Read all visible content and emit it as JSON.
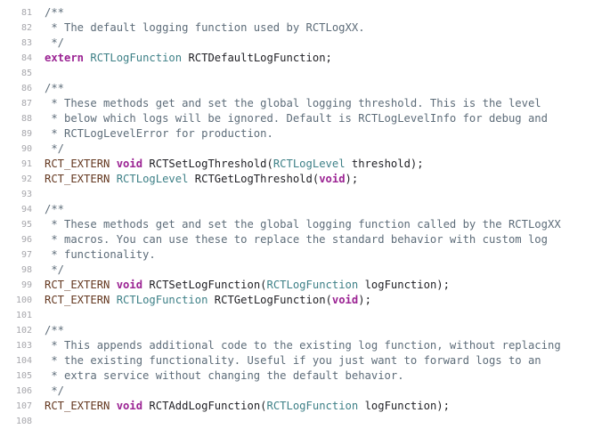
{
  "colors": {
    "background": "#ffffff",
    "line_number": "#a6a6ab",
    "comment": "#5d6c79",
    "keyword": "#9b2393",
    "type": "#3e8087",
    "plain": "#1f1f24",
    "macro": "#643820"
  },
  "lines": [
    {
      "num": "81",
      "tokens": [
        {
          "t": "comment",
          "s": "/**"
        }
      ]
    },
    {
      "num": "82",
      "tokens": [
        {
          "t": "comment",
          "s": " * The default logging function used by RCTLogXX."
        }
      ]
    },
    {
      "num": "83",
      "tokens": [
        {
          "t": "comment",
          "s": " */"
        }
      ]
    },
    {
      "num": "84",
      "tokens": [
        {
          "t": "keyword",
          "s": "extern"
        },
        {
          "t": "plain",
          "s": " "
        },
        {
          "t": "type",
          "s": "RCTLogFunction"
        },
        {
          "t": "plain",
          "s": " RCTDefaultLogFunction;"
        }
      ]
    },
    {
      "num": "85",
      "tokens": []
    },
    {
      "num": "86",
      "tokens": [
        {
          "t": "comment",
          "s": "/**"
        }
      ]
    },
    {
      "num": "87",
      "tokens": [
        {
          "t": "comment",
          "s": " * These methods get and set the global logging threshold. This is the level"
        }
      ]
    },
    {
      "num": "88",
      "tokens": [
        {
          "t": "comment",
          "s": " * below which logs will be ignored. Default is RCTLogLevelInfo for debug and"
        }
      ]
    },
    {
      "num": "89",
      "tokens": [
        {
          "t": "comment",
          "s": " * RCTLogLevelError for production."
        }
      ]
    },
    {
      "num": "90",
      "tokens": [
        {
          "t": "comment",
          "s": " */"
        }
      ]
    },
    {
      "num": "91",
      "tokens": [
        {
          "t": "macro",
          "s": "RCT_EXTERN"
        },
        {
          "t": "plain",
          "s": " "
        },
        {
          "t": "keyword",
          "s": "void"
        },
        {
          "t": "plain",
          "s": " RCTSetLogThreshold("
        },
        {
          "t": "type",
          "s": "RCTLogLevel"
        },
        {
          "t": "plain",
          "s": " threshold);"
        }
      ]
    },
    {
      "num": "92",
      "tokens": [
        {
          "t": "macro",
          "s": "RCT_EXTERN"
        },
        {
          "t": "plain",
          "s": " "
        },
        {
          "t": "type",
          "s": "RCTLogLevel"
        },
        {
          "t": "plain",
          "s": " RCTGetLogThreshold("
        },
        {
          "t": "keyword",
          "s": "void"
        },
        {
          "t": "plain",
          "s": ");"
        }
      ]
    },
    {
      "num": "93",
      "tokens": []
    },
    {
      "num": "94",
      "tokens": [
        {
          "t": "comment",
          "s": "/**"
        }
      ]
    },
    {
      "num": "95",
      "tokens": [
        {
          "t": "comment",
          "s": " * These methods get and set the global logging function called by the RCTLogXX"
        }
      ]
    },
    {
      "num": "96",
      "tokens": [
        {
          "t": "comment",
          "s": " * macros. You can use these to replace the standard behavior with custom log"
        }
      ]
    },
    {
      "num": "97",
      "tokens": [
        {
          "t": "comment",
          "s": " * functionality."
        }
      ]
    },
    {
      "num": "98",
      "tokens": [
        {
          "t": "comment",
          "s": " */"
        }
      ]
    },
    {
      "num": "99",
      "tokens": [
        {
          "t": "macro",
          "s": "RCT_EXTERN"
        },
        {
          "t": "plain",
          "s": " "
        },
        {
          "t": "keyword",
          "s": "void"
        },
        {
          "t": "plain",
          "s": " RCTSetLogFunction("
        },
        {
          "t": "type",
          "s": "RCTLogFunction"
        },
        {
          "t": "plain",
          "s": " logFunction);"
        }
      ]
    },
    {
      "num": "100",
      "tokens": [
        {
          "t": "macro",
          "s": "RCT_EXTERN"
        },
        {
          "t": "plain",
          "s": " "
        },
        {
          "t": "type",
          "s": "RCTLogFunction"
        },
        {
          "t": "plain",
          "s": " RCTGetLogFunction("
        },
        {
          "t": "keyword",
          "s": "void"
        },
        {
          "t": "plain",
          "s": ");"
        }
      ]
    },
    {
      "num": "101",
      "tokens": []
    },
    {
      "num": "102",
      "tokens": [
        {
          "t": "comment",
          "s": "/**"
        }
      ]
    },
    {
      "num": "103",
      "tokens": [
        {
          "t": "comment",
          "s": " * This appends additional code to the existing log function, without replacing"
        }
      ]
    },
    {
      "num": "104",
      "tokens": [
        {
          "t": "comment",
          "s": " * the existing functionality. Useful if you just want to forward logs to an"
        }
      ]
    },
    {
      "num": "105",
      "tokens": [
        {
          "t": "comment",
          "s": " * extra service without changing the default behavior."
        }
      ]
    },
    {
      "num": "106",
      "tokens": [
        {
          "t": "comment",
          "s": " */"
        }
      ]
    },
    {
      "num": "107",
      "tokens": [
        {
          "t": "macro",
          "s": "RCT_EXTERN"
        },
        {
          "t": "plain",
          "s": " "
        },
        {
          "t": "keyword",
          "s": "void"
        },
        {
          "t": "plain",
          "s": " RCTAddLogFunction("
        },
        {
          "t": "type",
          "s": "RCTLogFunction"
        },
        {
          "t": "plain",
          "s": " logFunction);"
        }
      ]
    },
    {
      "num": "108",
      "tokens": []
    }
  ]
}
